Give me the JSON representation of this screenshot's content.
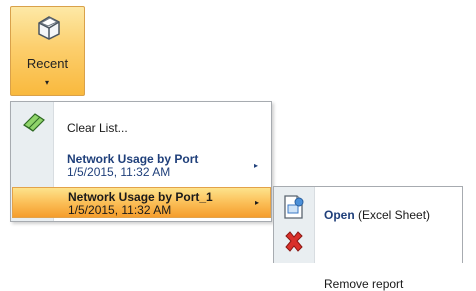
{
  "ribbon": {
    "recent_label": "Recent",
    "recent_icon": "recent-docs-icon",
    "dropdown_caret": "▾"
  },
  "menu": {
    "clear_list": "Clear List...",
    "clear_icon": "eraser-icon",
    "items": [
      {
        "title": "Network Usage by Port",
        "date": "1/5/2015, 11:32 AM",
        "arrow": "▸",
        "selected": false
      },
      {
        "title": "Network Usage by Port_1",
        "date": "1/5/2015, 11:32 AM",
        "arrow": "▸",
        "selected": true
      }
    ]
  },
  "submenu": {
    "open_strong": "Open",
    "open_suffix": " (Excel Sheet)",
    "open_icon": "open-document-icon",
    "remove_label": "Remove report",
    "remove_icon": "red-x-icon"
  },
  "colors": {
    "hover_orange": "#f9b93e",
    "link_blue": "#1f3f7a",
    "menu_gutter": "#e9eef1",
    "remove_red": "#d9302a"
  }
}
